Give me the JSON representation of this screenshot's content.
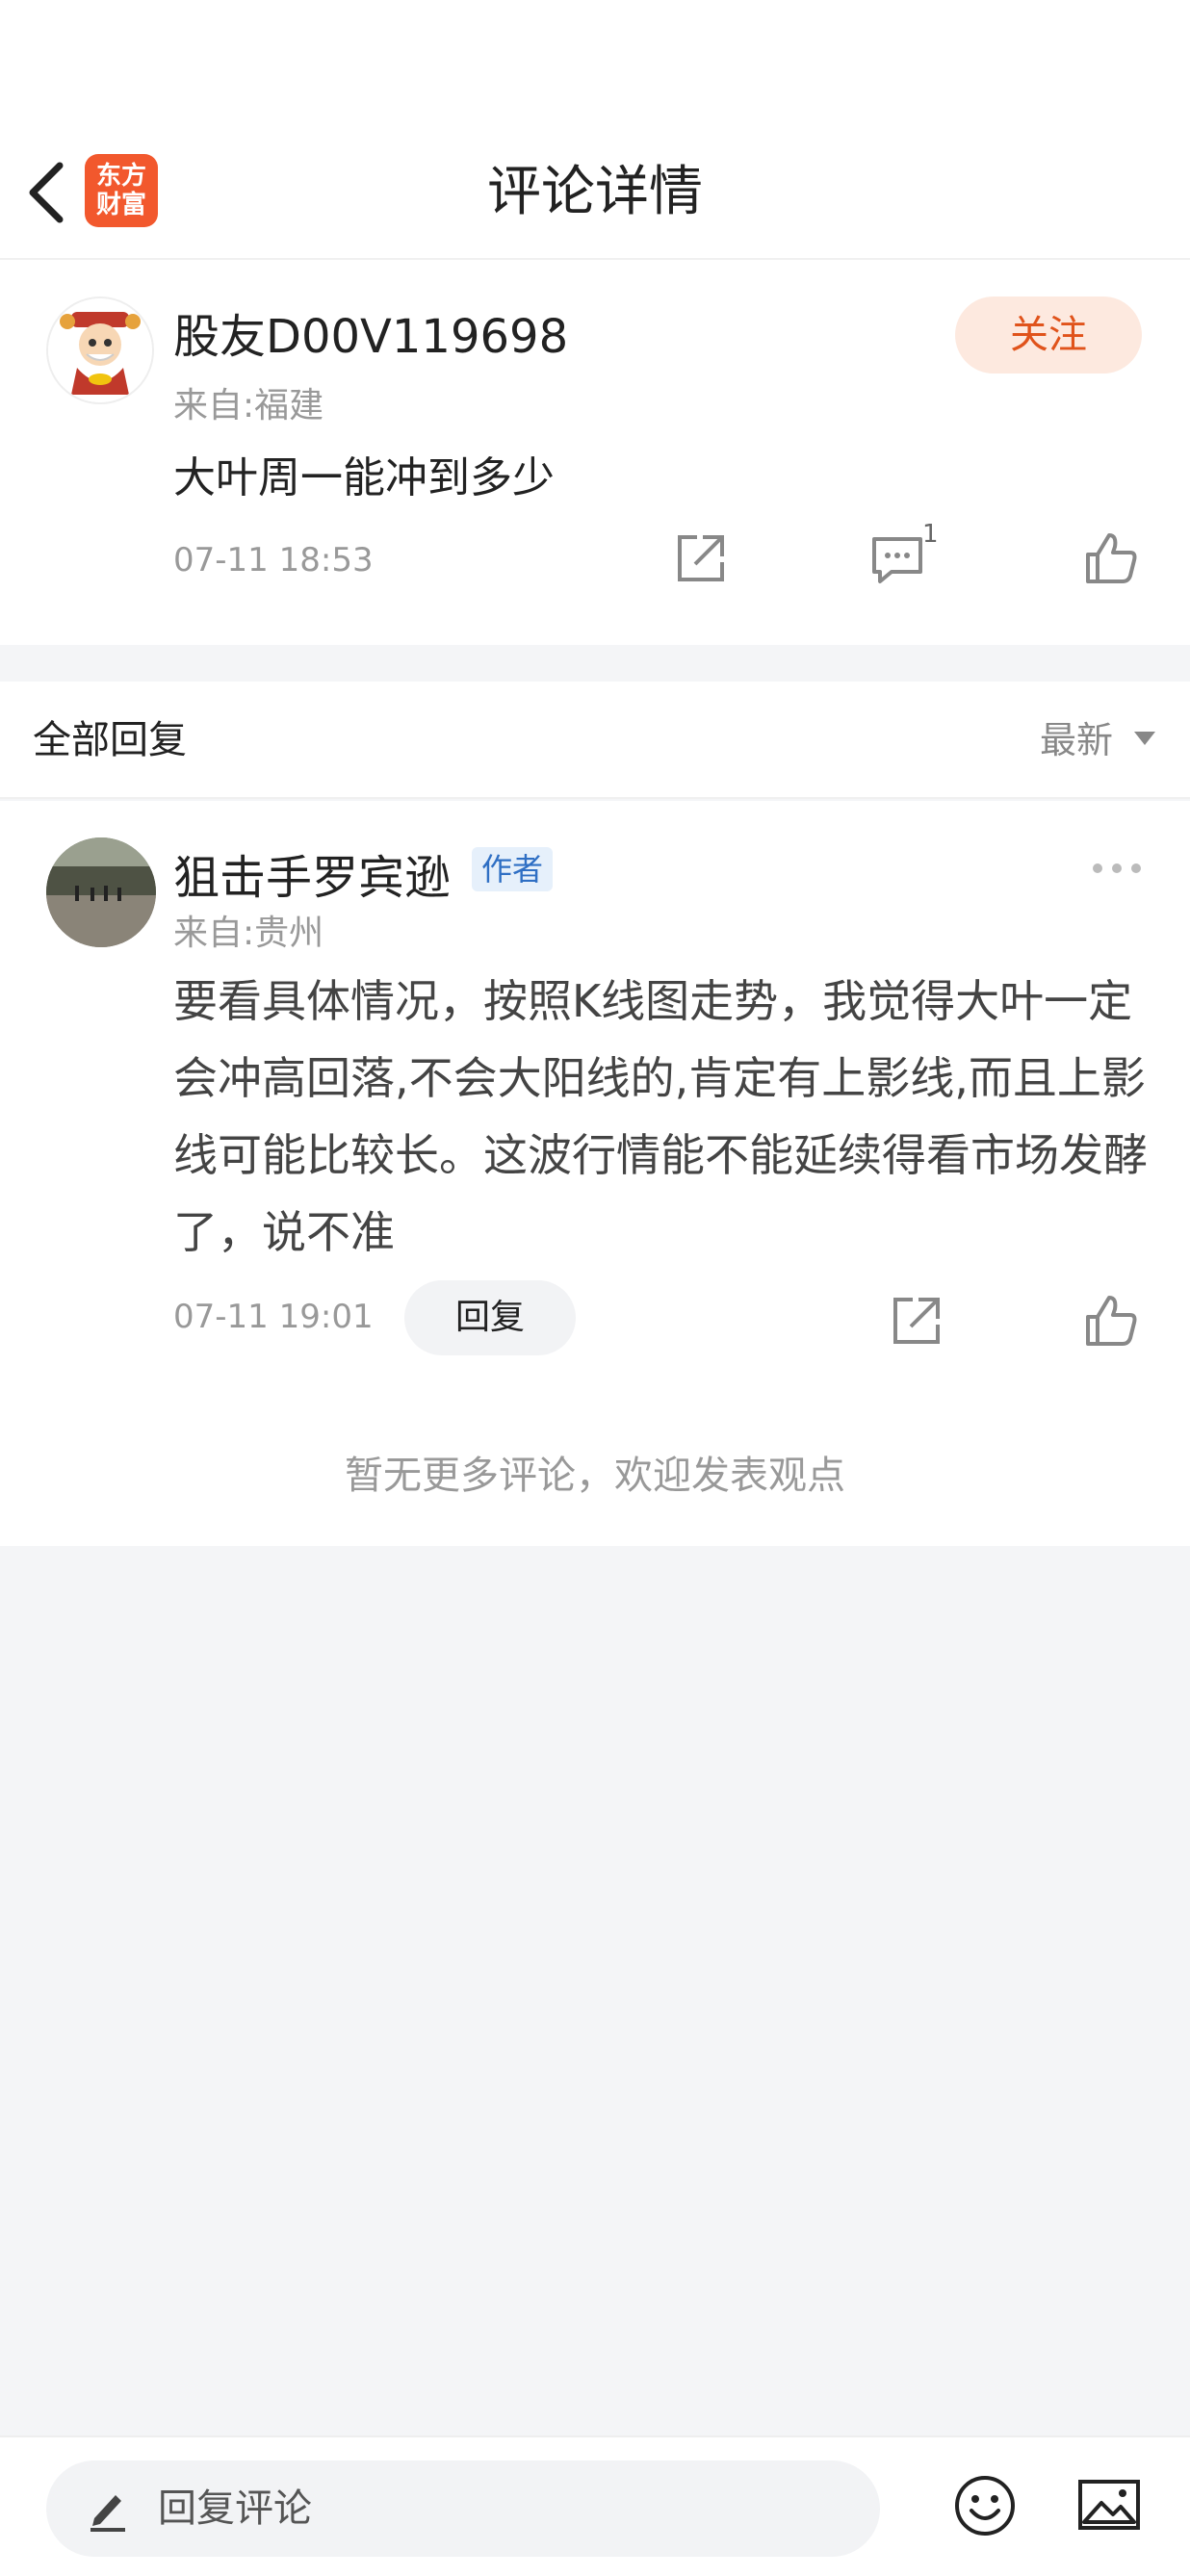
{
  "header": {
    "title": "评论详情",
    "logo_line1": "东方",
    "logo_line2": "财富"
  },
  "post": {
    "username": "股友D00V119698",
    "location": "来自:福建",
    "content": "大叶周一能冲到多少",
    "time": "07-11 18:53",
    "follow_label": "关注",
    "comment_count": "1"
  },
  "replies": {
    "section_title": "全部回复",
    "sort_label": "最新",
    "items": [
      {
        "username": "狙击手罗宾逊",
        "tag": "作者",
        "location": "来自:贵州",
        "content": "要看具体情况，按照K线图走势，我觉得大叶一定会冲高回落,不会大阳线的,肯定有上影线,而且上影线可能比较长。这波行情能不能延续得看市场发酵了，说不准",
        "time": "07-11 19:01",
        "reply_label": "回复"
      }
    ],
    "footer_text": "暂无更多评论，欢迎发表观点"
  },
  "bottom_bar": {
    "input_placeholder": "回复评论"
  },
  "colors": {
    "accent": "#e0531b",
    "logo_bg": "#f2582d",
    "author_tag": "#2f6fc4"
  }
}
